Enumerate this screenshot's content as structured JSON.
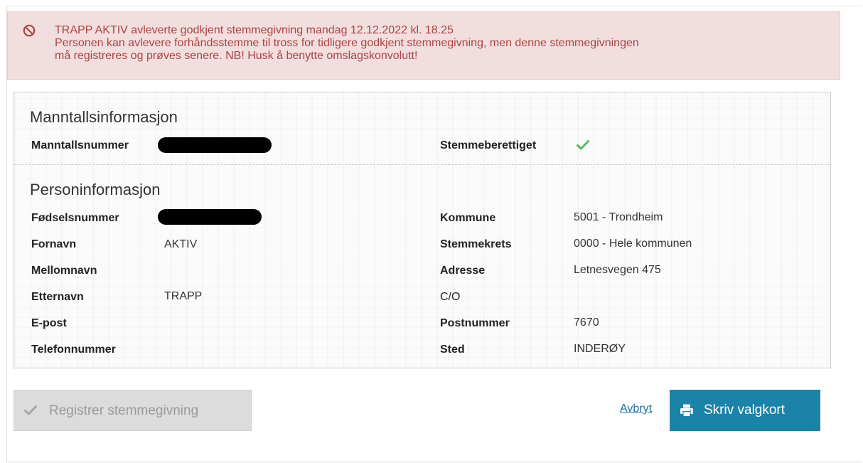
{
  "alert": {
    "icon": "ban-icon",
    "lines": [
      "TRAPP AKTIV avleverte godkjent stemmegivning mandag 12.12.2022 kl. 18.25",
      "Personen kan avlevere forhåndsstemme til tross for tidligere godkjent stemmegivning, men denne stemmegivningen",
      "må registreres og prøves senere. NB! Husk å benytte omslagskonvolutt!"
    ],
    "color": "#a94442",
    "background": "#f2dede"
  },
  "manntall": {
    "title": "Manntallsinformasjon",
    "number_label": "Manntallsnummer",
    "eligible_label": "Stemmeberettiget",
    "eligible_icon": "check-icon"
  },
  "person": {
    "title": "Personinformasjon",
    "fields_left": [
      {
        "label": "Fødselsnummer",
        "value": ""
      },
      {
        "label": "Fornavn",
        "value": "AKTIV"
      },
      {
        "label": "Mellomnavn",
        "value": ""
      },
      {
        "label": "Etternavn",
        "value": "TRAPP"
      },
      {
        "label": "E-post",
        "value": ""
      },
      {
        "label": "Telefonnummer",
        "value": ""
      }
    ],
    "fields_right": [
      {
        "label": "Kommune",
        "value": "5001 - Trondheim"
      },
      {
        "label": "Stemmekrets",
        "value": "0000 - Hele kommunen"
      },
      {
        "label": "Adresse",
        "value": "Letnesvegen 475"
      },
      {
        "label": "C/O",
        "value": ""
      },
      {
        "label": "Postnummer",
        "value": "7670"
      },
      {
        "label": "Sted",
        "value": "INDERØY"
      }
    ]
  },
  "actions": {
    "register_label": "Registrer stemmegivning",
    "register_icon": "check-icon",
    "cancel_label": "Avbryt",
    "print_label": "Skriv valgkort",
    "print_icon": "printer-icon",
    "print_color": "#1b82a8"
  },
  "colors": {
    "check": "#5cb85c"
  }
}
